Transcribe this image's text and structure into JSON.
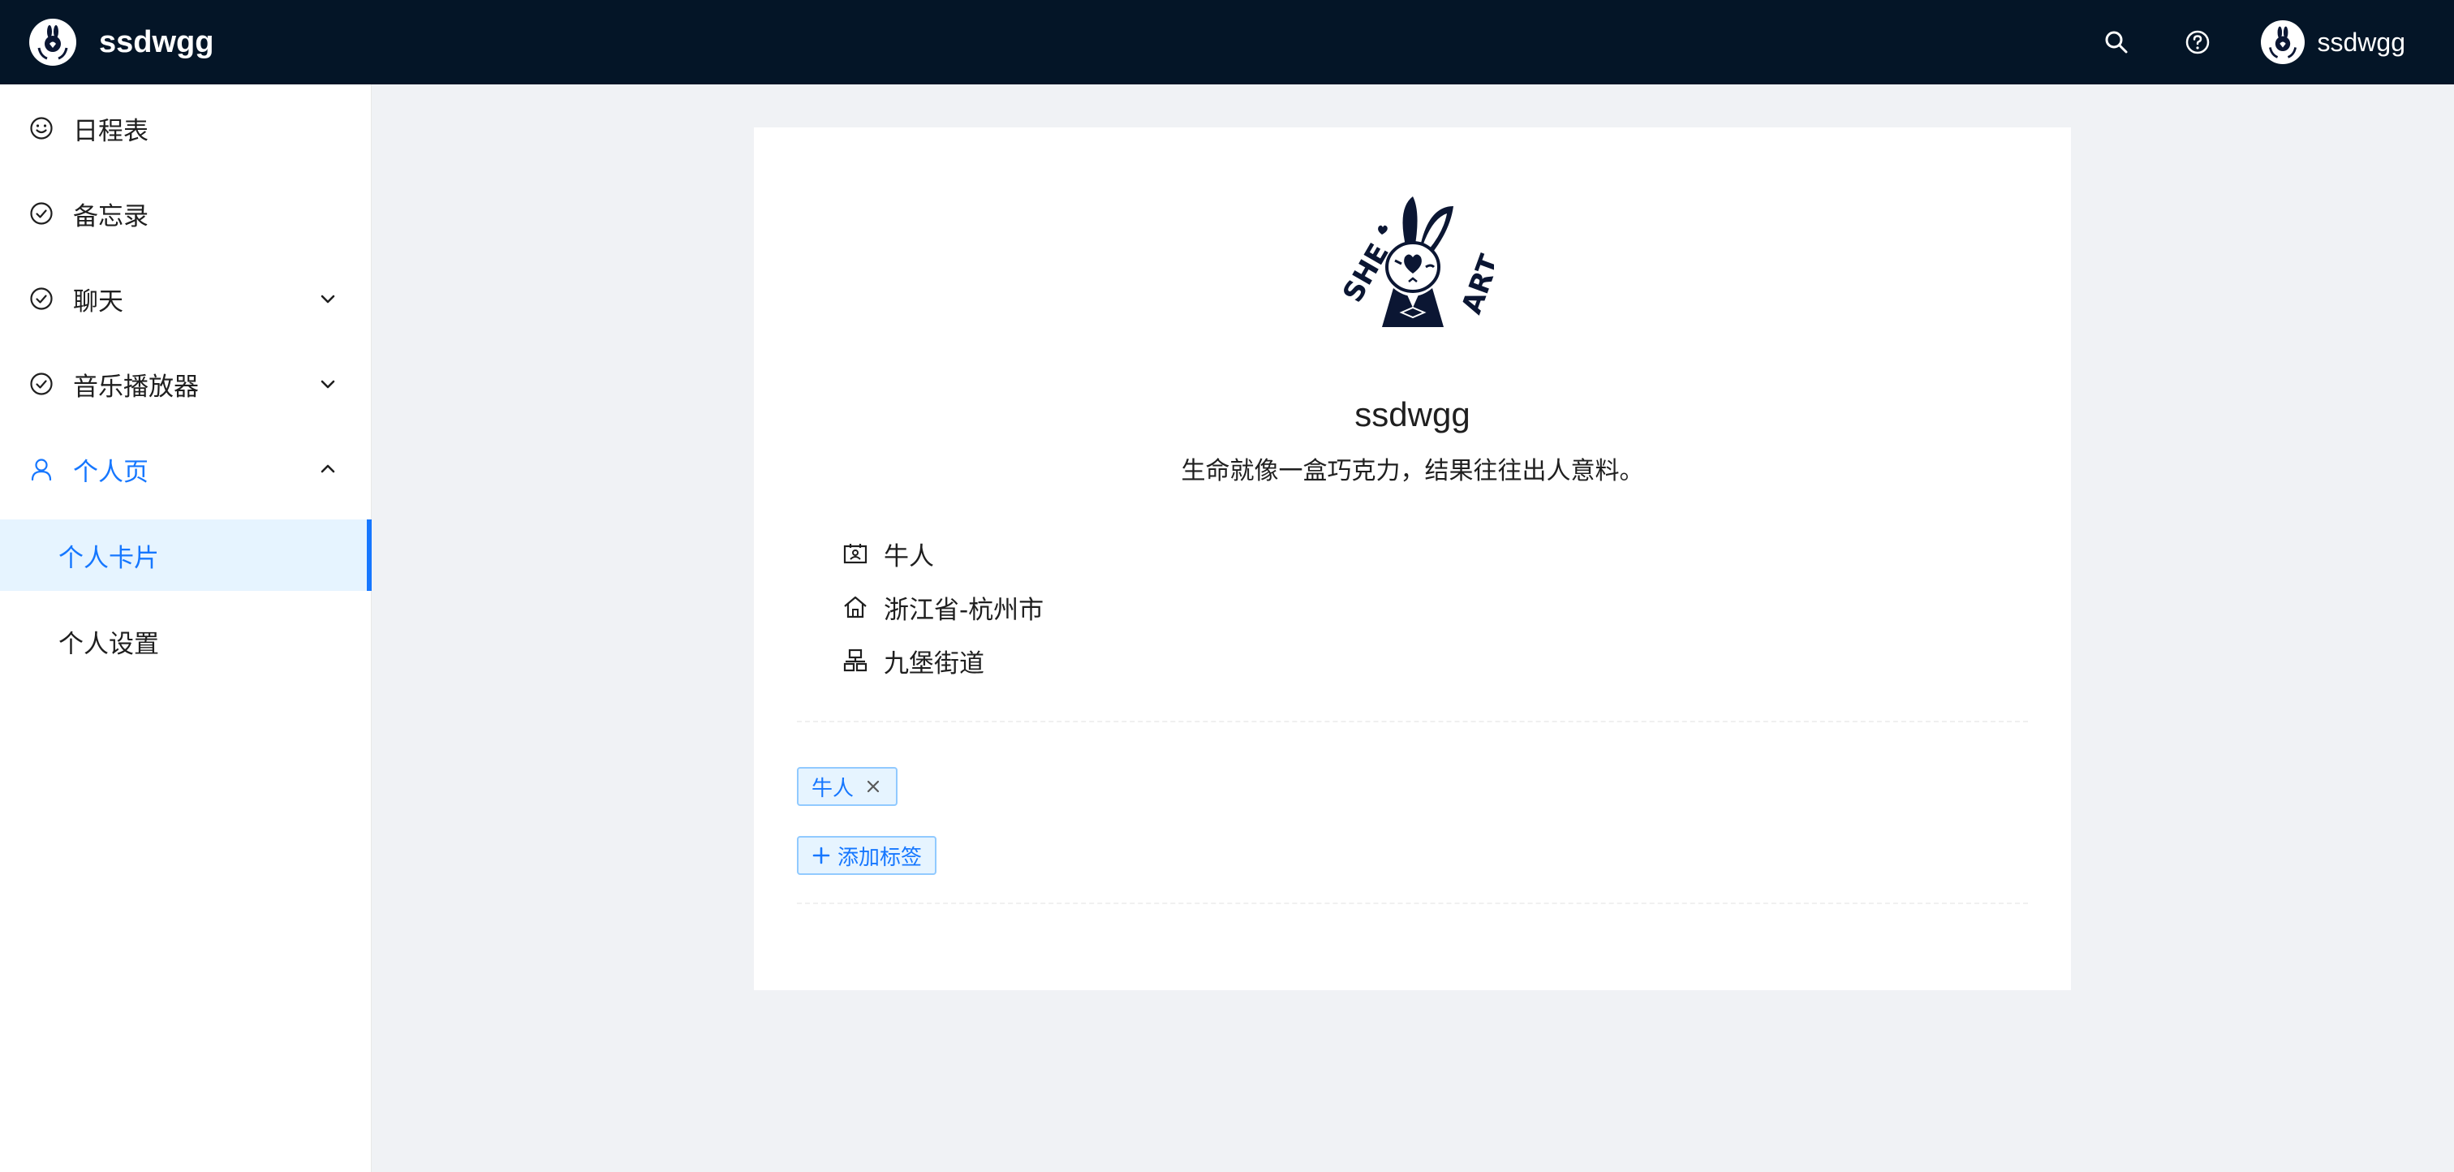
{
  "header": {
    "app_title": "ssdwgg",
    "user_name": "ssdwgg",
    "icons": [
      "search-icon",
      "help-icon"
    ]
  },
  "colors": {
    "header_bg": "#041527",
    "accent": "#1677ff",
    "page_bg": "#f0f2f5"
  },
  "sidebar": {
    "items": [
      {
        "label": "日程表",
        "icon": "smile-icon"
      },
      {
        "label": "备忘录",
        "icon": "check-circle-icon"
      },
      {
        "label": "聊天",
        "icon": "check-circle-icon",
        "expandable": true
      },
      {
        "label": "音乐播放器",
        "icon": "check-circle-icon",
        "expandable": true
      },
      {
        "label": "个人页",
        "icon": "user-icon",
        "expanded": true,
        "children": [
          {
            "label": "个人卡片",
            "selected": true
          },
          {
            "label": "个人设置"
          }
        ]
      }
    ]
  },
  "profile": {
    "name": "ssdwgg",
    "motto": "生命就像一盒巧克力，结果往往出人意料。",
    "info": [
      {
        "icon": "contacts-icon",
        "text": "牛人"
      },
      {
        "icon": "home-icon",
        "text": "浙江省-杭州市"
      },
      {
        "icon": "cluster-icon",
        "text": "九堡街道"
      }
    ],
    "tags": [
      "牛人"
    ],
    "add_tag_label": "添加标签"
  },
  "avatar_text": {
    "left": "SHE",
    "right": "ART"
  }
}
